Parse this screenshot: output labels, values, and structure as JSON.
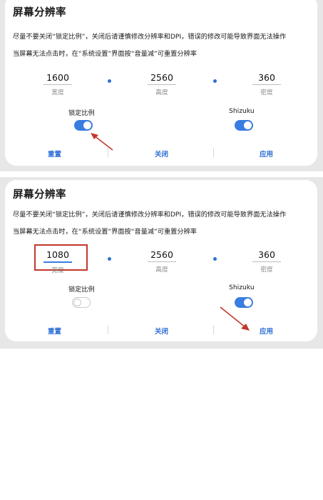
{
  "screens": [
    {
      "dialog_title": "屏幕分辨率",
      "hint_1": "尽量不要关闭“锁定比例”，关闭后请谨慎修改分辨率和DPI，错误的修改可能导致界面无法操作",
      "hint_2": "当屏幕无法点击时，在“系统设置”界面按“音量减”可重置分辨率",
      "width": {
        "value": "1600",
        "label": "宽度"
      },
      "height": {
        "value": "2560",
        "label": "高度"
      },
      "density": {
        "value": "360",
        "label": "密度"
      },
      "lock_ratio": {
        "label": "锁定比例",
        "on": true
      },
      "shizuku": {
        "label": "Shizuku",
        "on": true
      },
      "buttons": {
        "reset": "重置",
        "close": "关闭",
        "apply": "应用"
      }
    },
    {
      "dialog_title": "屏幕分辨率",
      "hint_1": "尽量不要关闭“锁定比例”，关闭后请谨慎修改分辨率和DPI，错误的修改可能导致界面无法操作",
      "hint_2": "当屏幕无法点击时，在“系统设置”界面按“音量减”可重置分辨率",
      "width": {
        "value": "1080",
        "label": "宽度"
      },
      "height": {
        "value": "2560",
        "label": "高度"
      },
      "density": {
        "value": "360",
        "label": "密度"
      },
      "lock_ratio": {
        "label": "锁定比例",
        "on": false
      },
      "shizuku": {
        "label": "Shizuku",
        "on": true
      },
      "buttons": {
        "reset": "重置",
        "close": "关闭",
        "apply": "应用"
      }
    }
  ],
  "colors": {
    "accent": "#3a7de0",
    "button_text": "#2f6fd6",
    "annotation": "#c0392b",
    "backdrop": "#e7e7e7"
  }
}
